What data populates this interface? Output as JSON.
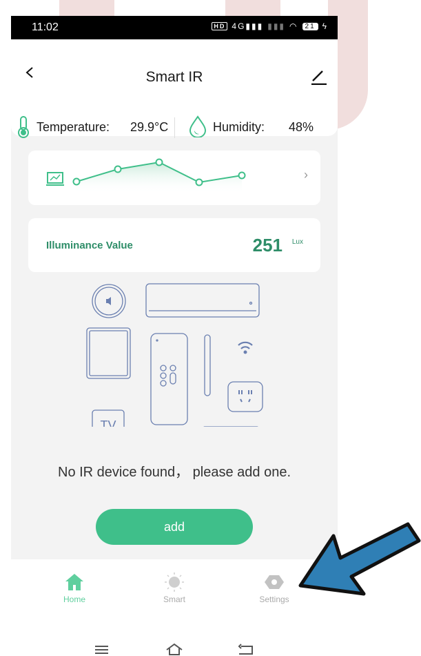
{
  "status_bar": {
    "time": "11:02",
    "network": "4G",
    "hd": "HD",
    "battery": "21"
  },
  "header": {
    "title": "Smart IR"
  },
  "environment": {
    "temperature_label": "Temperature:",
    "temperature_value": "29.9°C",
    "humidity_label": "Humidity:",
    "humidity_value": "48%"
  },
  "illuminance": {
    "label": "Illuminance Value",
    "value": "251",
    "unit": "Lux"
  },
  "devices": {
    "tv_label": "TV"
  },
  "empty_state": {
    "message": "No IR device found， please add one."
  },
  "add_button": {
    "label": "add"
  },
  "tabs": [
    {
      "label": "Home",
      "icon": "home-icon",
      "active": true
    },
    {
      "label": "Smart",
      "icon": "sun-icon",
      "active": false
    },
    {
      "label": "Settings",
      "icon": "hexagon-icon",
      "active": false
    }
  ],
  "colors": {
    "accent": "#3fbf8a",
    "accent_dark": "#2e8d68",
    "device_line": "#6a7fb0",
    "arrow": "#2f7fb5"
  }
}
